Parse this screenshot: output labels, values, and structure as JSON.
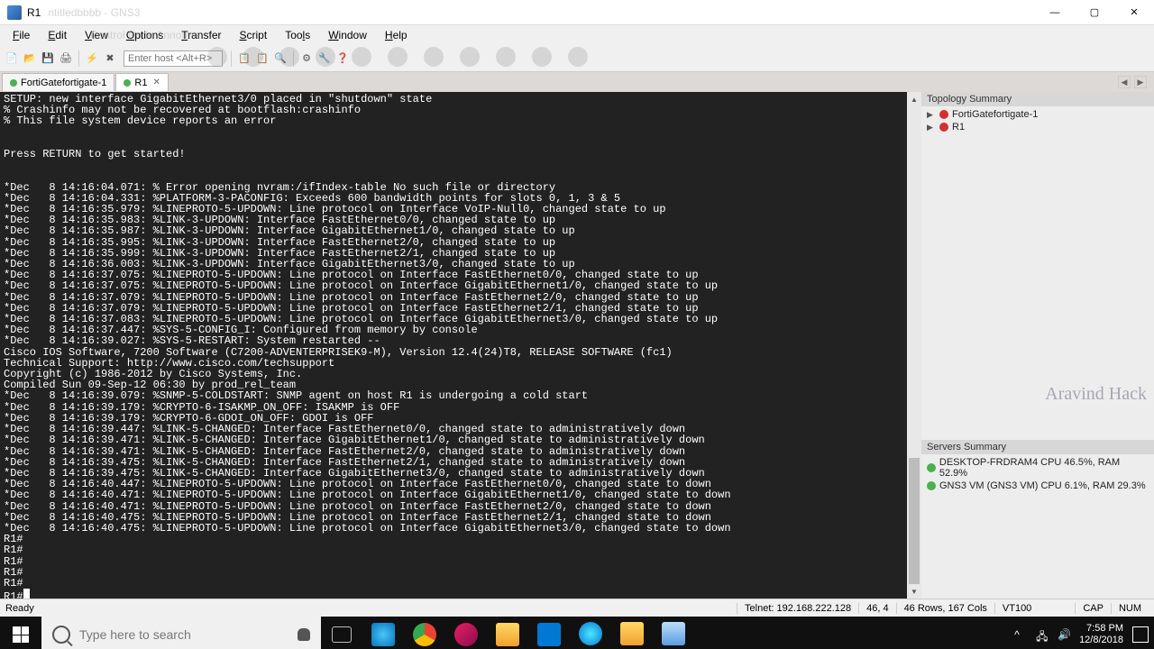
{
  "titlebar": {
    "title": "R1",
    "ghost_title": "ntitledbbbb - GNS3"
  },
  "menubar": {
    "items": [
      "File",
      "Edit",
      "View",
      "Options",
      "Transfer",
      "Script",
      "Tools",
      "Window",
      "Help"
    ],
    "ghost": "Control   Node   Annotate"
  },
  "toolbar": {
    "host_placeholder": "Enter host <Alt+R>"
  },
  "tabs": {
    "items": [
      {
        "label": "FortiGatefortigate-1",
        "active": false
      },
      {
        "label": "R1",
        "active": true,
        "closable": true
      }
    ]
  },
  "terminal_lines": [
    "SETUP: new interface GigabitEthernet3/0 placed in \"shutdown\" state",
    "% Crashinfo may not be recovered at bootflash:crashinfo",
    "% This file system device reports an error",
    "",
    "",
    "Press RETURN to get started!",
    "",
    "",
    "*Dec   8 14:16:04.071: % Error opening nvram:/ifIndex-table No such file or directory",
    "*Dec   8 14:16:04.331: %PLATFORM-3-PACONFIG: Exceeds 600 bandwidth points for slots 0, 1, 3 & 5",
    "*Dec   8 14:16:35.979: %LINEPROTO-5-UPDOWN: Line protocol on Interface VoIP-Null0, changed state to up",
    "*Dec   8 14:16:35.983: %LINK-3-UPDOWN: Interface FastEthernet0/0, changed state to up",
    "*Dec   8 14:16:35.987: %LINK-3-UPDOWN: Interface GigabitEthernet1/0, changed state to up",
    "*Dec   8 14:16:35.995: %LINK-3-UPDOWN: Interface FastEthernet2/0, changed state to up",
    "*Dec   8 14:16:35.999: %LINK-3-UPDOWN: Interface FastEthernet2/1, changed state to up",
    "*Dec   8 14:16:36.003: %LINK-3-UPDOWN: Interface GigabitEthernet3/0, changed state to up",
    "*Dec   8 14:16:37.075: %LINEPROTO-5-UPDOWN: Line protocol on Interface FastEthernet0/0, changed state to up",
    "*Dec   8 14:16:37.075: %LINEPROTO-5-UPDOWN: Line protocol on Interface GigabitEthernet1/0, changed state to up",
    "*Dec   8 14:16:37.079: %LINEPROTO-5-UPDOWN: Line protocol on Interface FastEthernet2/0, changed state to up",
    "*Dec   8 14:16:37.079: %LINEPROTO-5-UPDOWN: Line protocol on Interface FastEthernet2/1, changed state to up",
    "*Dec   8 14:16:37.083: %LINEPROTO-5-UPDOWN: Line protocol on Interface GigabitEthernet3/0, changed state to up",
    "*Dec   8 14:16:37.447: %SYS-5-CONFIG_I: Configured from memory by console",
    "*Dec   8 14:16:39.027: %SYS-5-RESTART: System restarted --",
    "Cisco IOS Software, 7200 Software (C7200-ADVENTERPRISEK9-M), Version 12.4(24)T8, RELEASE SOFTWARE (fc1)",
    "Technical Support: http://www.cisco.com/techsupport",
    "Copyright (c) 1986-2012 by Cisco Systems, Inc.",
    "Compiled Sun 09-Sep-12 06:30 by prod_rel_team",
    "*Dec   8 14:16:39.079: %SNMP-5-COLDSTART: SNMP agent on host R1 is undergoing a cold start",
    "*Dec   8 14:16:39.179: %CRYPTO-6-ISAKMP_ON_OFF: ISAKMP is OFF",
    "*Dec   8 14:16:39.179: %CRYPTO-6-GDOI_ON_OFF: GDOI is OFF",
    "*Dec   8 14:16:39.447: %LINK-5-CHANGED: Interface FastEthernet0/0, changed state to administratively down",
    "*Dec   8 14:16:39.471: %LINK-5-CHANGED: Interface GigabitEthernet1/0, changed state to administratively down",
    "*Dec   8 14:16:39.471: %LINK-5-CHANGED: Interface FastEthernet2/0, changed state to administratively down",
    "*Dec   8 14:16:39.475: %LINK-5-CHANGED: Interface FastEthernet2/1, changed state to administratively down",
    "*Dec   8 14:16:39.475: %LINK-5-CHANGED: Interface GigabitEthernet3/0, changed state to administratively down",
    "*Dec   8 14:16:40.447: %LINEPROTO-5-UPDOWN: Line protocol on Interface FastEthernet0/0, changed state to down",
    "*Dec   8 14:16:40.471: %LINEPROTO-5-UPDOWN: Line protocol on Interface GigabitEthernet1/0, changed state to down",
    "*Dec   8 14:16:40.471: %LINEPROTO-5-UPDOWN: Line protocol on Interface FastEthernet2/0, changed state to down",
    "*Dec   8 14:16:40.475: %LINEPROTO-5-UPDOWN: Line protocol on Interface FastEthernet2/1, changed state to down",
    "*Dec   8 14:16:40.475: %LINEPROTO-5-UPDOWN: Line protocol on Interface GigabitEthernet3/0, changed state to down",
    "R1#",
    "R1#",
    "R1#",
    "R1#",
    "R1#"
  ],
  "terminal_prompt": "R1#",
  "side": {
    "topology_title": "Topology Summary",
    "topology_items": [
      "FortiGatefortigate-1",
      "R1"
    ],
    "servers_title": "Servers Summary",
    "servers_items": [
      "DESKTOP-FRDRAM4 CPU 46.5%, RAM 52.9%",
      "GNS3 VM (GNS3 VM) CPU 6.1%, RAM 29.3%"
    ],
    "watermark": "Aravind Hack"
  },
  "statusbar": {
    "ready": "Ready",
    "conn": "Telnet: 192.168.222.128",
    "cursor": "46,   4",
    "size": "46 Rows, 167 Cols",
    "emu": "VT100",
    "cap": "CAP",
    "num": "NUM"
  },
  "taskbar": {
    "search_placeholder": "Type here to search",
    "time": "7:58 PM",
    "date": "12/8/2018"
  }
}
